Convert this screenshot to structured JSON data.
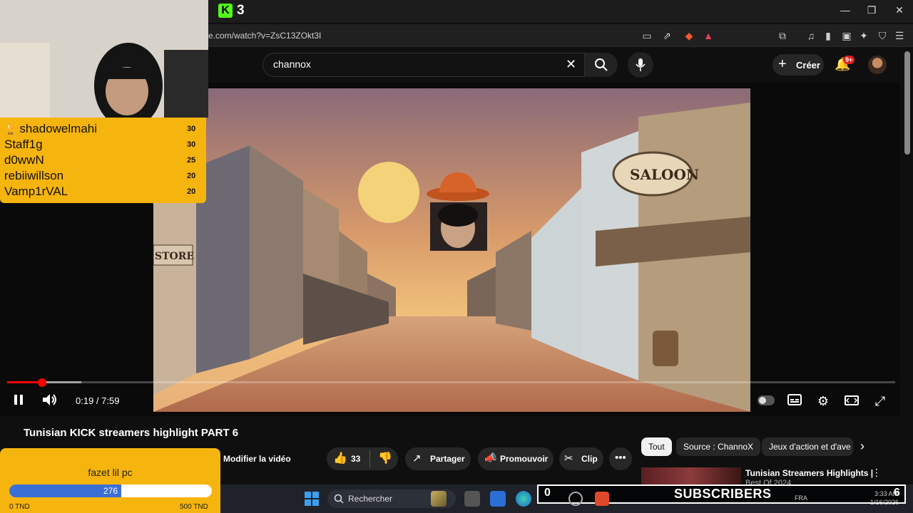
{
  "browser": {
    "kick_count": "3",
    "url": "e.com/watch?v=ZsC13ZOkt3I",
    "window_controls": [
      "—",
      "❐",
      "✕"
    ]
  },
  "youtube": {
    "search_value": "channox",
    "create_label": "Créer",
    "notif_badge": "9+"
  },
  "player": {
    "time": "0:19 / 7:59",
    "progress_fraction": 0.0397
  },
  "leaderboard": [
    {
      "name": "shadowelmahi",
      "score": "30"
    },
    {
      "name": "Staff1g",
      "score": "30"
    },
    {
      "name": "d0wwN",
      "score": "25"
    },
    {
      "name": "rebiiwillson",
      "score": "20"
    },
    {
      "name": "Vamp1rVAL",
      "score": "20"
    }
  ],
  "goal": {
    "title": "fazet lil pc",
    "current": "276",
    "min": "0 TND",
    "max": "500 TND",
    "fraction": 0.552
  },
  "video": {
    "title": "Tunisian KICK streamers highlight PART 6",
    "edit_label": "Modifier la vidéo",
    "likes": "33",
    "share_label": "Partager",
    "promote_label": "Promouvoir",
    "clip_label": "Clip"
  },
  "chips": [
    "Tout",
    "Source : ChannoX",
    "Jeux d'action et d'ave"
  ],
  "recommendation": {
    "title": "Tunisian Streamers Highlights |",
    "subtitle": "Best Of 2024"
  },
  "taskbar": {
    "search_label": "Rechercher",
    "subs_left": "0",
    "subs_label": "SUBSCRIBERS",
    "subs_count": "6",
    "lang": "FRA",
    "clock_time": "3:33 AM",
    "clock_date": "1/16/2026"
  },
  "colors": {
    "kick_green": "#53fc18",
    "overlay_yellow": "#f6b40e",
    "yt_red": "#ff0000",
    "goal_blue": "#3b6fd6"
  }
}
